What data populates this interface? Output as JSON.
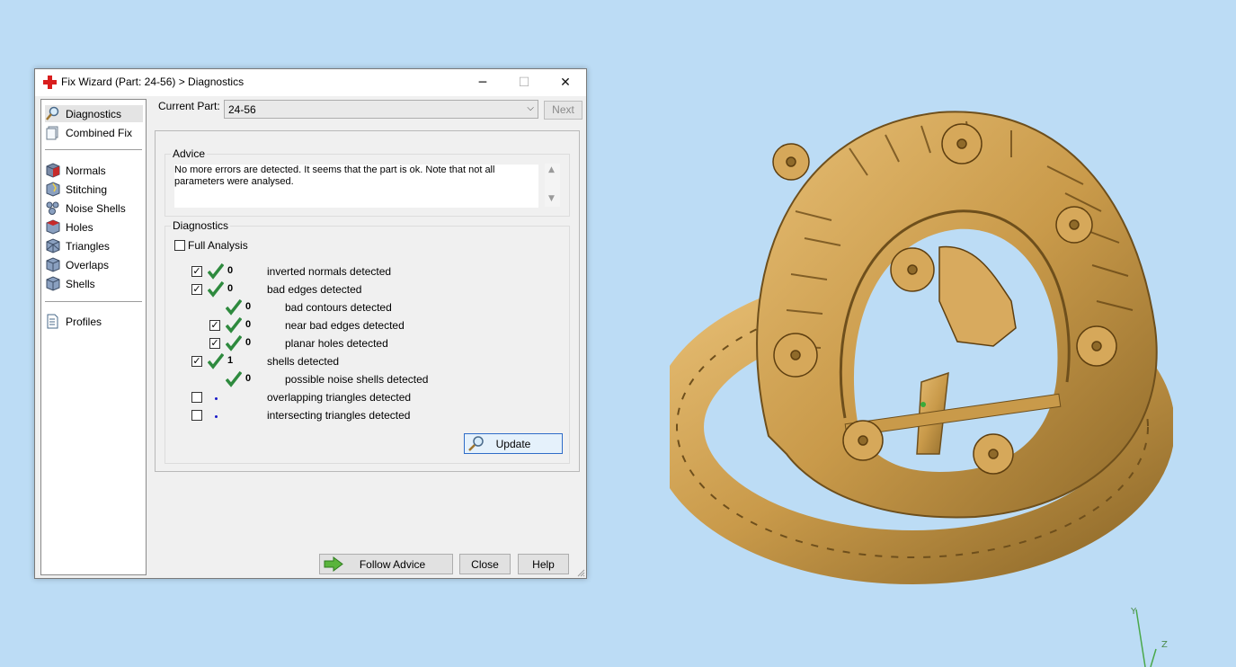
{
  "window": {
    "title": "Fix Wizard (Part: 24-56) > Diagnostics",
    "controls": {
      "minimize": "─",
      "maximize": "☐",
      "close": "✕"
    }
  },
  "sidebar": {
    "items": [
      {
        "label": "Diagnostics",
        "icon": "magnifier-icon",
        "selected": true
      },
      {
        "label": "Combined Fix",
        "icon": "stack-icon"
      },
      {
        "label": "Normals",
        "icon": "cube-red-icon"
      },
      {
        "label": "Stitching",
        "icon": "cube-stitch-icon"
      },
      {
        "label": "Noise Shells",
        "icon": "cube-noise-icon"
      },
      {
        "label": "Holes",
        "icon": "cube-holes-icon"
      },
      {
        "label": "Triangles",
        "icon": "cube-triangles-icon"
      },
      {
        "label": "Overlaps",
        "icon": "cube-overlaps-icon"
      },
      {
        "label": "Shells",
        "icon": "cube-shells-icon"
      },
      {
        "label": "Profiles",
        "icon": "document-icon"
      }
    ]
  },
  "topbar": {
    "current_part_label": "Current Part:",
    "current_part_value": "24-56",
    "next_label": "Next"
  },
  "advice": {
    "title": "Advice",
    "text": "No more errors are detected. It seems that the part is ok. Note that not all parameters were analysed."
  },
  "diagnostics": {
    "title": "Diagnostics",
    "full_analysis_label": "Full Analysis",
    "full_analysis_checked": false,
    "rows": [
      {
        "checkbox": true,
        "checked": true,
        "status": "ok",
        "count": "0",
        "label": "inverted normals detected"
      },
      {
        "checkbox": true,
        "checked": true,
        "status": "ok",
        "count": "0",
        "label": "bad edges detected"
      },
      {
        "checkbox": false,
        "status": "ok",
        "count": "0",
        "label": "bad contours detected"
      },
      {
        "checkbox": true,
        "checked": true,
        "status": "ok",
        "count": "0",
        "label": "near bad edges detected"
      },
      {
        "checkbox": true,
        "checked": true,
        "status": "ok",
        "count": "0",
        "label": "planar holes detected"
      },
      {
        "checkbox": true,
        "checked": true,
        "status": "ok",
        "count": "1",
        "label": "shells detected"
      },
      {
        "checkbox": false,
        "status": "ok",
        "count": "0",
        "label": "possible noise shells detected"
      },
      {
        "checkbox": true,
        "checked": false,
        "status": "unknown",
        "count": "",
        "label": "overlapping triangles detected"
      },
      {
        "checkbox": true,
        "checked": false,
        "status": "unknown",
        "count": "",
        "label": "intersecting triangles detected"
      }
    ],
    "update_label": "Update"
  },
  "footer": {
    "follow_advice_label": "Follow Advice",
    "close_label": "Close",
    "help_label": "Help"
  },
  "viewport": {
    "axis_y": "Y",
    "axis_z": "Z",
    "model_color": "#c99a4a"
  }
}
